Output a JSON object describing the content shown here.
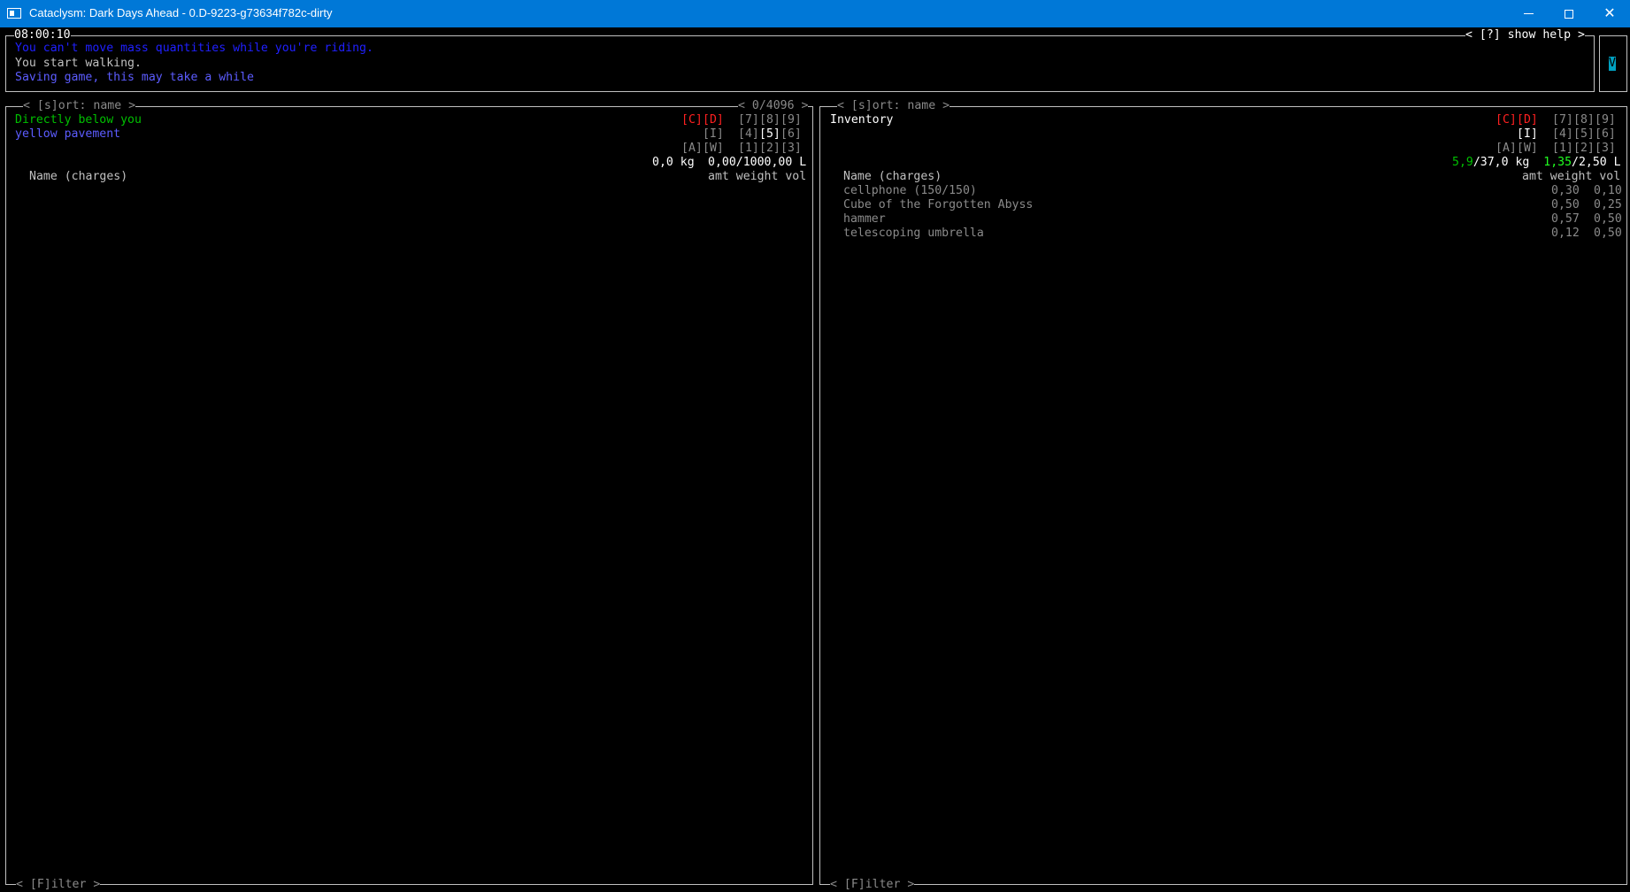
{
  "window": {
    "title": "Cataclysm: Dark Days Ahead - 0.D-9223-g73634f782c-dirty",
    "icons": [
      "app-icon",
      "minimize-icon",
      "maximize-icon",
      "close-icon"
    ]
  },
  "message_log": {
    "time": "08:00:10",
    "help": "< [?] show help >",
    "messages": [
      {
        "text": "You can't move mass quantities while you're riding.",
        "color": "#2020ff"
      },
      {
        "text": "You start walking.",
        "color": "#c0c0c0"
      },
      {
        "text": "Saving game, this may take a while",
        "color": "#5c5cff"
      }
    ],
    "scroll_indicator": "V"
  },
  "left_pane": {
    "sort_label": "< [s]ort: name >",
    "page_count": "< 0/4096 >",
    "location": "Directly below you",
    "terrain": "yellow pavement",
    "keys": {
      "c": "[C]",
      "d": "[D]",
      "k7": "[7]",
      "k8": "[8]",
      "k9": "[9]",
      "i": "[I]",
      "k4": "[4]",
      "k5": "[5]",
      "k6": "[6]",
      "a": "[A]",
      "w": "[W]",
      "k1": "[1]",
      "k2": "[2]",
      "k3": "[3]"
    },
    "weight": "0,0 kg",
    "volume": "0,00/1000,00 L",
    "col_name": "Name (charges)",
    "col_stats": "amt weight vol",
    "filter_label": "< [F]ilter >"
  },
  "right_pane": {
    "sort_label": "< [s]ort: name >",
    "title": "Inventory",
    "keys": {
      "c": "[C]",
      "d": "[D]",
      "k7": "[7]",
      "k8": "[8]",
      "k9": "[9]",
      "i": "[I]",
      "k4": "[4]",
      "k5": "[5]",
      "k6": "[6]",
      "a": "[A]",
      "w": "[W]",
      "k1": "[1]",
      "k2": "[2]",
      "k3": "[3]"
    },
    "weight_current": "5,9",
    "weight_max": "/37,0 kg",
    "volume_current": "1,35",
    "volume_max": "/2,50 L",
    "col_name": "Name (charges)",
    "col_stats": "amt weight vol",
    "items": [
      {
        "name": "cellphone (150/150)",
        "weight": "0,30",
        "volume": "0,10"
      },
      {
        "name": "Cube of the Forgotten Abyss",
        "weight": "0,50",
        "volume": "0,25"
      },
      {
        "name": "hammer",
        "weight": "0,57",
        "volume": "0,50"
      },
      {
        "name": "telescoping umbrella",
        "weight": "0,12",
        "volume": "0,50"
      }
    ],
    "filter_label": "< [F]ilter >"
  }
}
